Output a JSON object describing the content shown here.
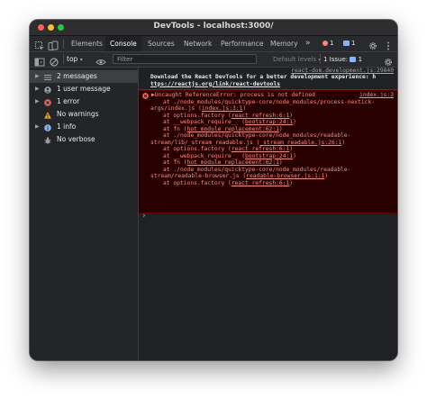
{
  "window": {
    "title": "DevTools - localhost:3000/"
  },
  "tabs": [
    {
      "label": "Elements",
      "active": false
    },
    {
      "label": "Console",
      "active": true
    },
    {
      "label": "Sources",
      "active": false
    },
    {
      "label": "Network",
      "active": false
    },
    {
      "label": "Performance",
      "active": false
    },
    {
      "label": "Memory",
      "active": false
    }
  ],
  "more_tabs": "»",
  "badges": {
    "errors": "1",
    "messages": "1"
  },
  "toolbar": {
    "context": "top",
    "filter_placeholder": "Filter",
    "levels": "Default levels",
    "issues_label": "1 Issue:",
    "issues_count": "1"
  },
  "sidebar": {
    "items": [
      {
        "label": "2 messages",
        "icon": "list-icon",
        "expandable": true,
        "selected": true
      },
      {
        "label": "1 user message",
        "icon": "user-icon",
        "expandable": true,
        "selected": false
      },
      {
        "label": "1 error",
        "icon": "error-icon",
        "expandable": true,
        "selected": false
      },
      {
        "label": "No warnings",
        "icon": "warning-icon",
        "expandable": false,
        "selected": false
      },
      {
        "label": "1 info",
        "icon": "info-icon",
        "expandable": true,
        "selected": false
      },
      {
        "label": "No verbose",
        "icon": "bug-icon",
        "expandable": false,
        "selected": false
      }
    ]
  },
  "console": {
    "info_message": {
      "source": "react-dom.development.js:29840",
      "line1": "Download the React DevTools for a better development experience: h",
      "line2": "ttps://reactjs.org/link/react-devtools"
    },
    "error_message": {
      "source": "index.js:3",
      "header": "▶Uncaught ReferenceError: process is not defined",
      "line1_prefix": "at ./node_modules/quicktype-core/node_modules/process-nextick-",
      "line2_prefix": "args/index.js (",
      "line2_link": "index.js:3:1",
      "line2_suffix": ")",
      "line3_prefix": "at options.factory (",
      "line3_link": "react refresh:6:1",
      "line3_suffix": ")",
      "line4_prefix": "at __webpack_require__ (",
      "line4_link": "bootstrap:24:1",
      "line4_suffix": ")",
      "line5_prefix": "at fn (",
      "line5_link": "hot module replacement:62:1",
      "line5_suffix": ")",
      "line6_prefix": "at ./node_modules/quicktype-core/node_modules/readable-",
      "line7_prefix": "stream/lib/_stream_readable.js (",
      "line7_link": "_stream_readable.js:26:1",
      "line7_suffix": ")",
      "line8_prefix": "at options.factory (",
      "line8_link": "react refresh:6:1",
      "line8_suffix": ")",
      "line9_prefix": "at __webpack_require__ (",
      "line9_link": "bootstrap:24:1",
      "line9_suffix": ")",
      "line10_prefix": "at fn (",
      "line10_link": "hot module replacement:62:1",
      "line10_suffix": ")",
      "line11_prefix": "at ./node_modules/quicktype-core/node_modules/readable-",
      "line12_prefix": "stream/readable-browser.js (",
      "line12_link": "readable-browser.js:1:1",
      "line12_suffix": ")",
      "line13_prefix": "at options.factory (",
      "line13_link": "react refresh:6:1",
      "line13_suffix": ")"
    },
    "prompt": "›"
  },
  "colors": {
    "error_bg": "#290000",
    "error_text": "#f28b82",
    "link_blue": "#8ab4f8",
    "active_tab_bg": "#202124"
  }
}
